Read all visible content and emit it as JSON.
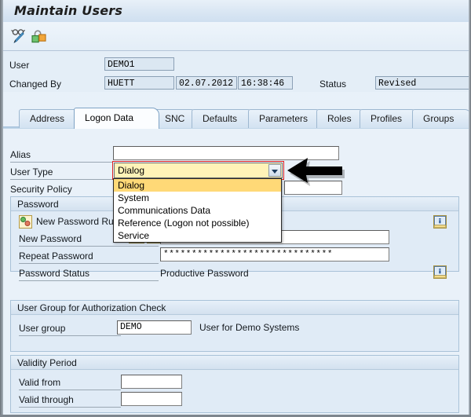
{
  "window": {
    "title": "Maintain Users"
  },
  "toolbar": {
    "items": [
      {
        "name": "display-change-icon",
        "tooltip": "Display <-> Change"
      },
      {
        "name": "authorization-icon",
        "tooltip": "Authorizations"
      }
    ]
  },
  "header": {
    "user_label": "User",
    "user_value": "DEMO1",
    "changed_by_label": "Changed By",
    "changed_by_value": "HUETT",
    "changed_date": "02.07.2012",
    "changed_time": "16:38:46",
    "status_label": "Status",
    "status_value": "Revised"
  },
  "tabs": [
    {
      "label": "Address",
      "active": false
    },
    {
      "label": "Logon Data",
      "active": true
    },
    {
      "label": "SNC",
      "active": false
    },
    {
      "label": "Defaults",
      "active": false
    },
    {
      "label": "Parameters",
      "active": false
    },
    {
      "label": "Roles",
      "active": false
    },
    {
      "label": "Profiles",
      "active": false
    },
    {
      "label": "Groups",
      "active": false
    }
  ],
  "form": {
    "alias_label": "Alias",
    "alias_value": "",
    "user_type_label": "User Type",
    "user_type_value": "Dialog",
    "user_type_options": [
      "Dialog",
      "System",
      "Communications Data",
      "Reference (Logon not possible)",
      "Service"
    ],
    "user_type_selected_index": 0,
    "security_policy_label": "Security Policy",
    "security_policy_value": ""
  },
  "password_section": {
    "title": "Password",
    "new_password_rule_label": "New Password Rule",
    "new_password_label": "New Password",
    "new_password_value": "********************",
    "repeat_password_label": "Repeat Password",
    "repeat_password_value": "******************************",
    "password_status_label": "Password Status",
    "password_status_value": "Productive Password"
  },
  "user_group_section": {
    "title": "User Group for Authorization Check",
    "user_group_label": "User group",
    "user_group_value": "DEMO",
    "user_group_description": "User for Demo Systems"
  },
  "validity_section": {
    "title": "Validity Period",
    "valid_from_label": "Valid from",
    "valid_from_value": "",
    "valid_through_label": "Valid through",
    "valid_through_value": ""
  },
  "annotation": {
    "name": "pointer-arrow",
    "direction": "left"
  },
  "colors": {
    "combo_background": "#fff3b8",
    "dropdown_selected": "#ffd977",
    "focus_ring": "#e02020",
    "pane_background": "#e9f1f9",
    "group_header": "#d3e1ef"
  }
}
